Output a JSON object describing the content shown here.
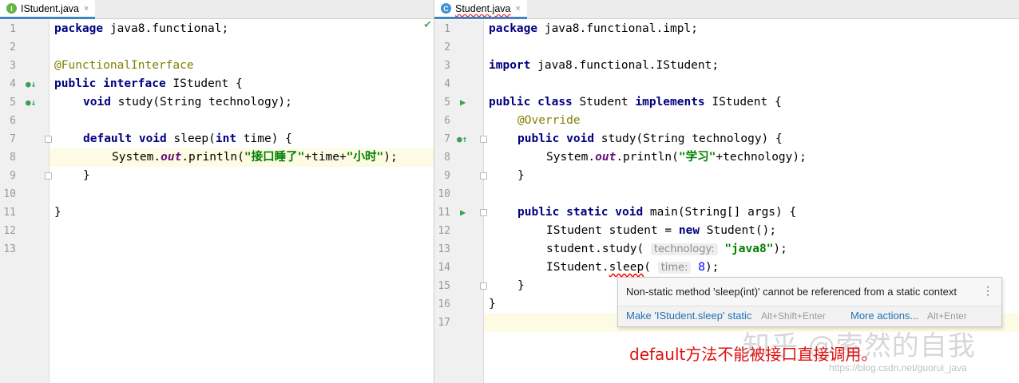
{
  "left": {
    "tab": {
      "label": "IStudent.java",
      "icon": "interface-file-icon",
      "close": "×"
    },
    "line_numbers": [
      "1",
      "2",
      "3",
      "4",
      "5",
      "6",
      "7",
      "8",
      "9",
      "10",
      "11",
      "12",
      "13"
    ],
    "code": {
      "l1_kw": "package",
      "l1_rest": " java8.functional;",
      "l3_ann": "@FunctionalInterface",
      "l4_kw1": "public",
      "l4_kw2": "interface",
      "l4_rest": " IStudent {",
      "l5_kw": "void",
      "l5_rest": " study(String technology);",
      "l7_kw1": "default",
      "l7_kw2": "void",
      "l7_mid": " sleep(",
      "l7_kw3": "int",
      "l7_rest": " time) {",
      "l8_a": "System.",
      "l8_fld": "out",
      "l8_b": ".println(",
      "l8_s1": "\"接口睡了\"",
      "l8_c": "+time+",
      "l8_s2": "\"小时\"",
      "l8_d": ");",
      "l9": "}",
      "l11": "}"
    },
    "status_check": "✔"
  },
  "right": {
    "tab": {
      "label": "Student.java",
      "icon": "class-file-icon",
      "close": "×"
    },
    "line_numbers": [
      "1",
      "2",
      "3",
      "4",
      "5",
      "6",
      "7",
      "8",
      "9",
      "10",
      "11",
      "12",
      "13",
      "14",
      "15",
      "16",
      "17"
    ],
    "code": {
      "l1_kw": "package",
      "l1_rest": " java8.functional.impl;",
      "l3_kw": "import",
      "l3_rest": " java8.functional.IStudent;",
      "l5_kw1": "public",
      "l5_kw2": "class",
      "l5_mid": " Student ",
      "l5_kw3": "implements",
      "l5_rest": " IStudent {",
      "l6_ann": "@Override",
      "l7_kw1": "public",
      "l7_kw2": "void",
      "l7_rest": " study(String technology) {",
      "l8_a": "System.",
      "l8_fld": "out",
      "l8_b": ".println(",
      "l8_s": "\"学习\"",
      "l8_c": "+technology);",
      "l9": "}",
      "l11_kw1": "public",
      "l11_kw2": "static",
      "l11_kw3": "void",
      "l11_rest": " main(String[] args) {",
      "l12_a": "IStudent student = ",
      "l12_kw": "new",
      "l12_b": " Student();",
      "l13_a": "student.study(",
      "l13_hint": "technology:",
      "l13_s": "\"java8\"",
      "l13_b": ");",
      "l14_a": "IStudent.",
      "l14_err": "sleep",
      "l14_b": "(",
      "l14_hint": "time:",
      "l14_num": "8",
      "l14_c": ");",
      "l15": "}",
      "l16": "}"
    }
  },
  "popup": {
    "message": "Non-static method 'sleep(int)' cannot be referenced from a static context",
    "menu": "⋮",
    "action1": "Make 'IStudent.sleep' static",
    "action1_key": "Alt+Shift+Enter",
    "action2": "More actions...",
    "action2_key": "Alt+Enter"
  },
  "note": "default方法不能被接口直接调用。",
  "watermark": "知乎 @索然的自我",
  "watermark_url": "https://blog.csdn.net/guorui_java"
}
